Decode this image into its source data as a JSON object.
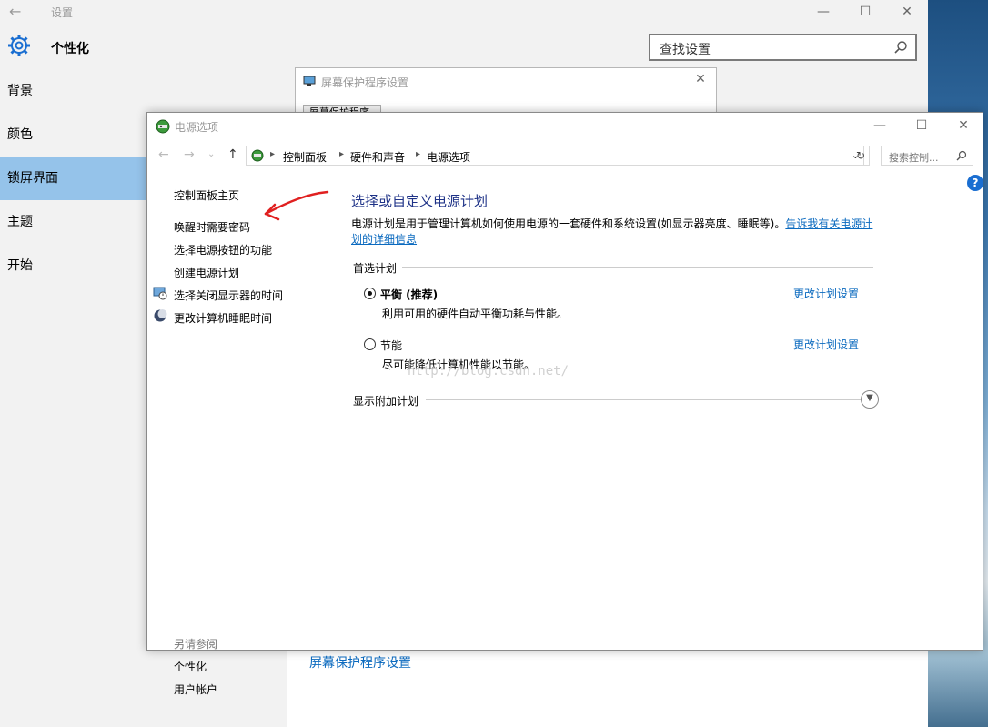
{
  "settings": {
    "app_title": "设置",
    "section_title": "个性化",
    "search_placeholder": "查找设置",
    "nav": [
      "背景",
      "颜色",
      "锁屏界面",
      "主题",
      "开始"
    ],
    "active_nav_index": 2,
    "saver_link": "屏幕保护程序设置",
    "window_buttons": {
      "minimize": "—",
      "maximize": "☐",
      "close": "✕"
    }
  },
  "saver_dialog": {
    "title": "屏幕保护程序设置",
    "tab": "屏幕保护程序",
    "close": "✕"
  },
  "power": {
    "title": "电源选项",
    "window_buttons": {
      "minimize": "—",
      "maximize": "☐",
      "close": "✕"
    },
    "nav_buttons": {
      "back": "←",
      "forward": "→",
      "recent": "⌄",
      "up": "↑"
    },
    "breadcrumbs": [
      "控制面板",
      "硬件和声音",
      "电源选项"
    ],
    "search_placeholder": "搜索控制...",
    "refresh": "↻",
    "left_links": [
      "控制面板主页",
      "唤醒时需要密码",
      "选择电源按钮的功能",
      "创建电源计划",
      "选择关闭显示器的时间",
      "更改计算机睡眠时间"
    ],
    "see_also_header": "另请参阅",
    "see_also_links": [
      "个性化",
      "用户帐户"
    ],
    "main_title": "选择或自定义电源计划",
    "description": "电源计划是用于管理计算机如何使用电源的一套硬件和系统设置(如显示器亮度、睡眠等)。",
    "description_link": "告诉我有关电源计划的详细信息",
    "preferred_header": "首选计划",
    "plans": [
      {
        "name": "平衡 (推荐)",
        "desc": "利用可用的硬件自动平衡功耗与性能。",
        "link": "更改计划设置",
        "selected": true
      },
      {
        "name": "节能",
        "desc": "尽可能降低计算机性能以节能。",
        "link": "更改计划设置",
        "selected": false
      }
    ],
    "watermark": "http://blog.csdn.net/",
    "more_plans_header": "显示附加计划",
    "help": "?"
  },
  "colors": {
    "accent": "#95c3ea",
    "link": "#0b6abf",
    "title_blue": "#1e3287",
    "annotation_red": "#e02020"
  }
}
